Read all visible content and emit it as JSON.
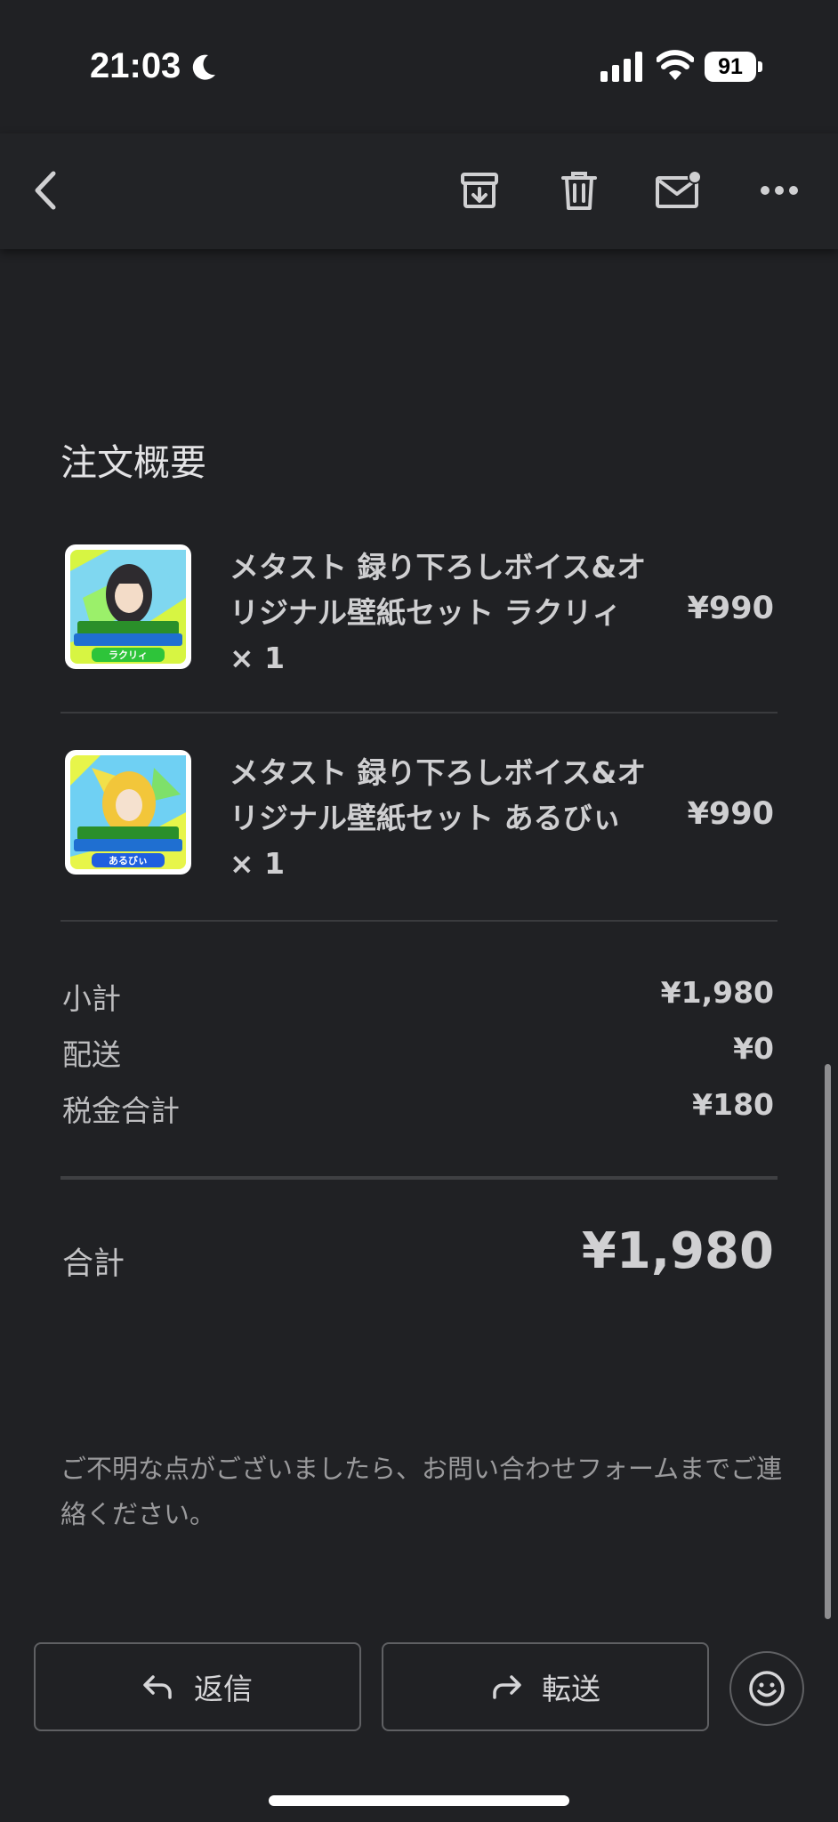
{
  "status_bar": {
    "time": "21:03",
    "battery": "91"
  },
  "toolbar": {
    "back_icon": "chevron-left-icon",
    "archive_icon": "archive-icon",
    "delete_icon": "trash-icon",
    "mark_unread_icon": "mail-unread-icon",
    "more_icon": "more-horizontal-icon"
  },
  "order": {
    "title": "注文概要",
    "items": [
      {
        "name": "メタスト 録り下ろしボイス&オリジナル壁紙セット ラクリィ × 1",
        "price": "¥990",
        "thumb_label": "ラクリィ"
      },
      {
        "name": "メタスト 録り下ろしボイス&オリジナル壁紙セット あるびぃ × 1",
        "price": "¥990",
        "thumb_label": "あるびぃ"
      }
    ],
    "summary": [
      {
        "label": "小計",
        "value": "¥1,980"
      },
      {
        "label": "配送",
        "value": "¥0"
      },
      {
        "label": "税金合計",
        "value": "¥180"
      }
    ],
    "total_label": "合計",
    "total_value": "¥1,980"
  },
  "note": "ご不明な点がございましたら、お問い合わせフォームまでご連絡ください。",
  "actions": {
    "reply_label": "返信",
    "forward_label": "転送",
    "emoji_icon": "smiley-icon"
  }
}
